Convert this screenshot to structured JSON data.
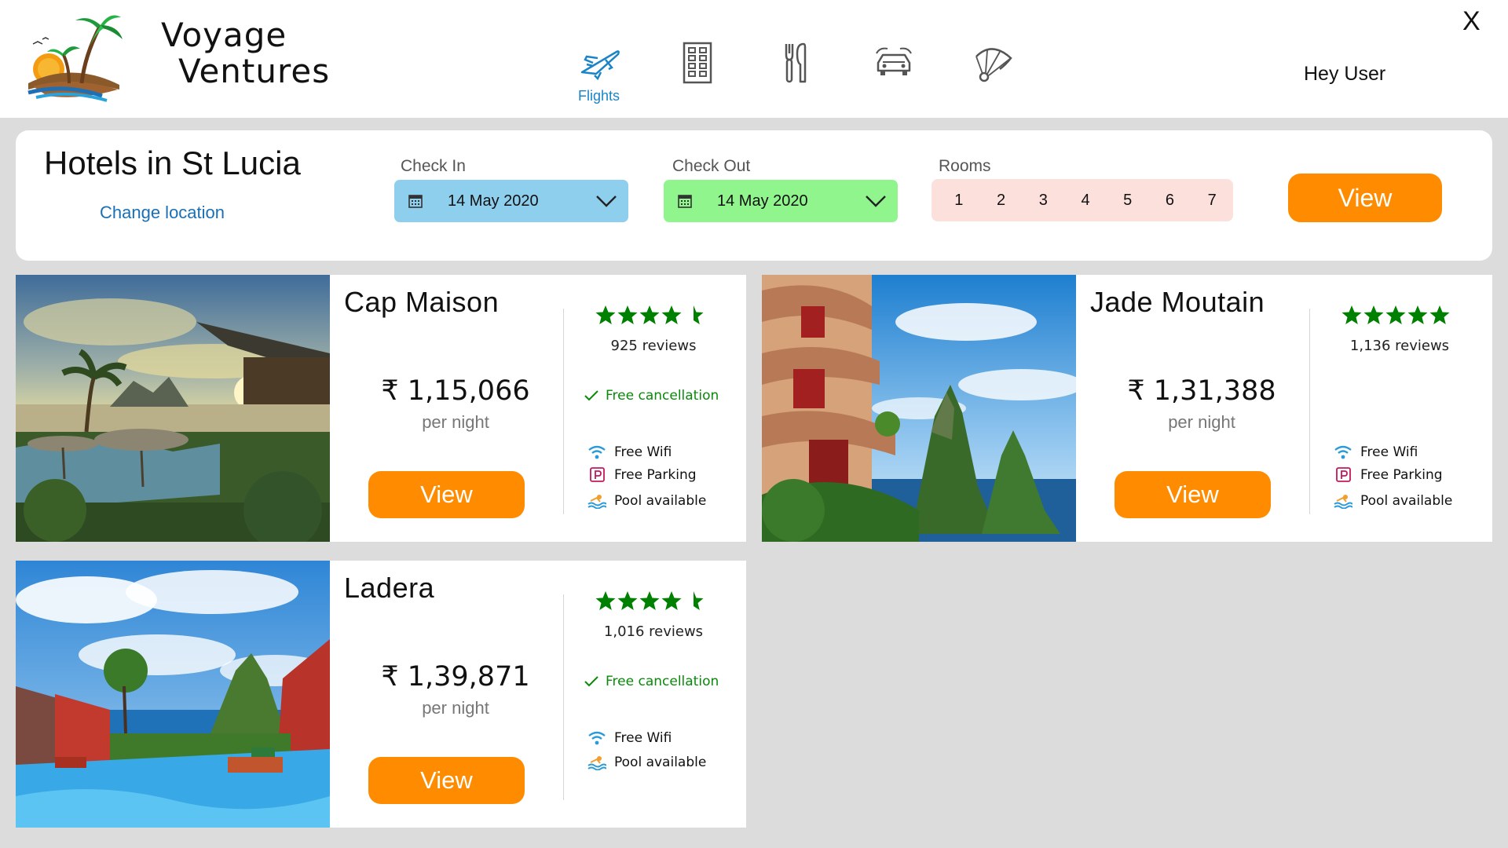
{
  "header": {
    "brand_line1": "Voyage",
    "brand_line2": "Ventures",
    "nav": [
      {
        "label": "Flights",
        "icon": "airplane-icon"
      },
      {
        "label": "",
        "icon": "hotel-building-icon"
      },
      {
        "label": "",
        "icon": "restaurant-icon"
      },
      {
        "label": "",
        "icon": "car-icon"
      },
      {
        "label": "",
        "icon": "parachute-icon"
      }
    ],
    "greeting": "Hey User",
    "close_label": "X"
  },
  "search": {
    "title": "Hotels in St Lucia",
    "change_location": "Change location",
    "check_in_label": "Check In",
    "check_in_value": "14 May 2020",
    "check_out_label": "Check Out",
    "check_out_value": "14 May 2020",
    "rooms_label": "Rooms",
    "rooms": [
      "1",
      "2",
      "3",
      "4",
      "5",
      "6",
      "7"
    ],
    "view_label": "View"
  },
  "colors": {
    "accent": "#ff8c00",
    "check_in_bg": "#8ecfee",
    "check_out_bg": "#8ff58c",
    "rooms_bg": "#fce0dc",
    "link": "#1a6fb5",
    "star": "#008000"
  },
  "hotels": [
    {
      "name": "Cap Maison",
      "price": "₹ 1,15,066",
      "per": "per night",
      "view": "View",
      "rating": 4.5,
      "reviews": "925 reviews",
      "free_cancellation": "Free cancellation",
      "amenities": [
        {
          "label": "Free Wifi",
          "icon": "wifi-icon"
        },
        {
          "label": "Free Parking",
          "icon": "parking-icon"
        },
        {
          "label": "Pool available",
          "icon": "pool-icon"
        }
      ]
    },
    {
      "name": "Jade Moutain",
      "price": "₹ 1,31,388",
      "per": "per night",
      "view": "View",
      "rating": 5,
      "reviews": "1,136 reviews",
      "amenities": [
        {
          "label": "Free Wifi",
          "icon": "wifi-icon"
        },
        {
          "label": "Free Parking",
          "icon": "parking-icon"
        },
        {
          "label": "Pool available",
          "icon": "pool-icon"
        }
      ]
    },
    {
      "name": "Ladera",
      "price": "₹ 1,39,871",
      "per": "per night",
      "view": "View",
      "rating": 4.5,
      "reviews": "1,016 reviews",
      "free_cancellation": "Free cancellation",
      "amenities": [
        {
          "label": "Free Wifi",
          "icon": "wifi-icon"
        },
        {
          "label": "Pool available",
          "icon": "pool-icon"
        }
      ]
    }
  ]
}
